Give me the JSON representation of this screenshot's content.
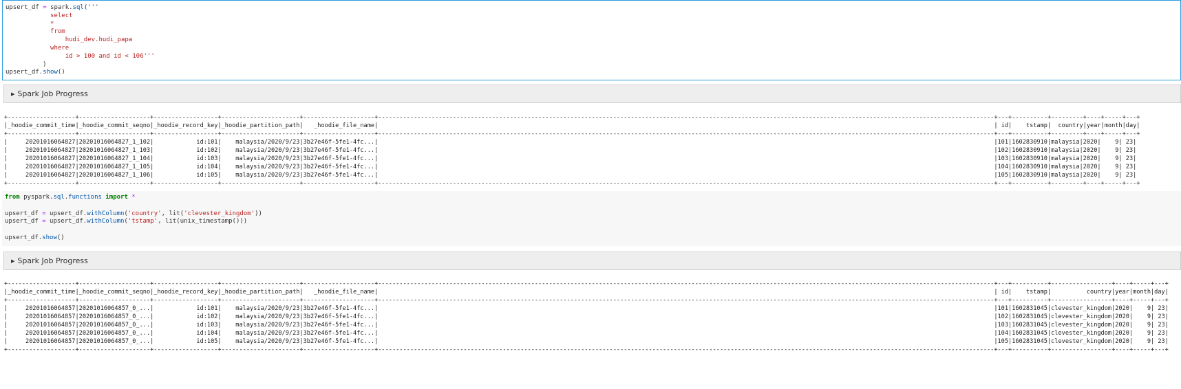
{
  "cell1": {
    "code_lines": [
      [
        {
          "t": "upsert_df ",
          "c": ""
        },
        {
          "t": "=",
          "c": "op"
        },
        {
          "t": " spark",
          "c": ""
        },
        {
          "t": ".",
          "c": ""
        },
        {
          "t": "sql",
          "c": "fn"
        },
        {
          "t": "('''",
          "c": ""
        }
      ],
      [
        {
          "t": "            select",
          "c": "str"
        }
      ],
      [
        {
          "t": "            *",
          "c": "str"
        }
      ],
      [
        {
          "t": "            from",
          "c": "str"
        }
      ],
      [
        {
          "t": "                hudi_dev.hudi_papa",
          "c": "str"
        }
      ],
      [
        {
          "t": "            where",
          "c": "str"
        }
      ],
      [
        {
          "t": "                id > 100 and id < 106'''",
          "c": "str"
        }
      ],
      [
        {
          "t": "          )",
          "c": ""
        }
      ],
      [
        {
          "t": "upsert_df",
          "c": ""
        },
        {
          "t": ".",
          "c": ""
        },
        {
          "t": "show",
          "c": "fn"
        },
        {
          "t": "()",
          "c": ""
        }
      ]
    ]
  },
  "progress1": {
    "label": "Spark Job Progress"
  },
  "output1": {
    "lines": [
      "+-------------------+--------------------+------------------+----------------------+--------------------+-----------------------------------------------------------------------------------------------------------------------------------------------------------------------------+---+----------+---------+----+-----+---+",
      "|_hoodie_commit_time|_hoodie_commit_seqno|_hoodie_record_key|_hoodie_partition_path|   _hoodie_file_name|                                                                                                                                                                             | id|    tstamp|  country|year|month|day|",
      "+-------------------+--------------------+------------------+----------------------+--------------------+-----------------------------------------------------------------------------------------------------------------------------------------------------------------------------+---+----------+---------+----+-----+---+",
      "|     20201016064827|20201016064827_1_102|            id:101|    malaysia/2020/9/23|3b27e46f-5fe1-4fc...|                                                                                                                                                                             |101|1602830910|malaysia|2020|    9| 23|",
      "|     20201016064827|20201016064827_1_103|            id:102|    malaysia/2020/9/23|3b27e46f-5fe1-4fc...|                                                                                                                                                                             |102|1602830910|malaysia|2020|    9| 23|",
      "|     20201016064827|20201016064827_1_104|            id:103|    malaysia/2020/9/23|3b27e46f-5fe1-4fc...|                                                                                                                                                                             |103|1602830910|malaysia|2020|    9| 23|",
      "|     20201016064827|20201016064827_1_105|            id:104|    malaysia/2020/9/23|3b27e46f-5fe1-4fc...|                                                                                                                                                                             |104|1602830910|malaysia|2020|    9| 23|",
      "|     20201016064827|20201016064827_1_106|            id:105|    malaysia/2020/9/23|3b27e46f-5fe1-4fc...|                                                                                                                                                                             |105|1602830910|malaysia|2020|    9| 23|",
      "+-------------------+--------------------+------------------+----------------------+--------------------+-----------------------------------------------------------------------------------------------------------------------------------------------------------------------------+---+----------+---------+----+-----+---+"
    ]
  },
  "cell2": {
    "code_lines": [
      [
        {
          "t": "from",
          "c": "kw"
        },
        {
          "t": " pyspark",
          "c": ""
        },
        {
          "t": ".",
          "c": ""
        },
        {
          "t": "sql",
          "c": "fn"
        },
        {
          "t": ".",
          "c": ""
        },
        {
          "t": "functions",
          "c": "fn"
        },
        {
          "t": " ",
          "c": ""
        },
        {
          "t": "import",
          "c": "kw"
        },
        {
          "t": " ",
          "c": ""
        },
        {
          "t": "*",
          "c": "op"
        }
      ],
      [
        {
          "t": "",
          "c": ""
        }
      ],
      [
        {
          "t": "upsert_df ",
          "c": ""
        },
        {
          "t": "=",
          "c": "op"
        },
        {
          "t": " upsert_df",
          "c": ""
        },
        {
          "t": ".",
          "c": ""
        },
        {
          "t": "withColumn",
          "c": "fn"
        },
        {
          "t": "(",
          "c": ""
        },
        {
          "t": "'country'",
          "c": "str"
        },
        {
          "t": ", lit(",
          "c": ""
        },
        {
          "t": "'clevester_kingdom'",
          "c": "str"
        },
        {
          "t": "))",
          "c": ""
        }
      ],
      [
        {
          "t": "upsert_df ",
          "c": ""
        },
        {
          "t": "=",
          "c": "op"
        },
        {
          "t": " upsert_df",
          "c": ""
        },
        {
          "t": ".",
          "c": ""
        },
        {
          "t": "withColumn",
          "c": "fn"
        },
        {
          "t": "(",
          "c": ""
        },
        {
          "t": "'tstamp'",
          "c": "str"
        },
        {
          "t": ", lit(unix_timestamp()))",
          "c": ""
        }
      ],
      [
        {
          "t": "",
          "c": ""
        }
      ],
      [
        {
          "t": "upsert_df",
          "c": ""
        },
        {
          "t": ".",
          "c": ""
        },
        {
          "t": "show",
          "c": "fn"
        },
        {
          "t": "()",
          "c": ""
        }
      ]
    ]
  },
  "progress2": {
    "label": "Spark Job Progress"
  },
  "output2": {
    "lines": [
      "+-------------------+--------------------+------------------+----------------------+--------------------+-----------------------------------------------------------------------------------------------------------------------------------------------------------------------------+---+----------+-----------------+----+-----+---+",
      "|_hoodie_commit_time|_hoodie_commit_seqno|_hoodie_record_key|_hoodie_partition_path|   _hoodie_file_name|                                                                                                                                                                             | id|    tstamp|          country|year|month|day|",
      "+-------------------+--------------------+------------------+----------------------+--------------------+-----------------------------------------------------------------------------------------------------------------------------------------------------------------------------+---+----------+-----------------+----+-----+---+",
      "|     20201016064857|20201016064857_0_...|            id:101|    malaysia/2020/9/23|3b27e46f-5fe1-4fc...|                                                                                                                                                                             |101|1602831045|clevester_kingdom|2020|    9| 23|",
      "|     20201016064857|20201016064857_0_...|            id:102|    malaysia/2020/9/23|3b27e46f-5fe1-4fc...|                                                                                                                                                                             |102|1602831045|clevester_kingdom|2020|    9| 23|",
      "|     20201016064857|20201016064857_0_...|            id:103|    malaysia/2020/9/23|3b27e46f-5fe1-4fc...|                                                                                                                                                                             |103|1602831045|clevester_kingdom|2020|    9| 23|",
      "|     20201016064857|20201016064857_0_...|            id:104|    malaysia/2020/9/23|3b27e46f-5fe1-4fc...|                                                                                                                                                                             |104|1602831045|clevester_kingdom|2020|    9| 23|",
      "|     20201016064857|20201016064857_0_...|            id:105|    malaysia/2020/9/23|3b27e46f-5fe1-4fc...|                                                                                                                                                                             |105|1602831045|clevester_kingdom|2020|    9| 23|",
      "+-------------------+--------------------+------------------+----------------------+--------------------+-----------------------------------------------------------------------------------------------------------------------------------------------------------------------------+---+----------+-----------------+----+-----+---+"
    ]
  },
  "colors": {
    "selected_border": "#2b9de0",
    "keyword": "#008000",
    "string": "#ba2121",
    "function": "#0055aa",
    "operator": "#aa22ff"
  },
  "icons": {
    "expand": "caret-right-icon"
  }
}
